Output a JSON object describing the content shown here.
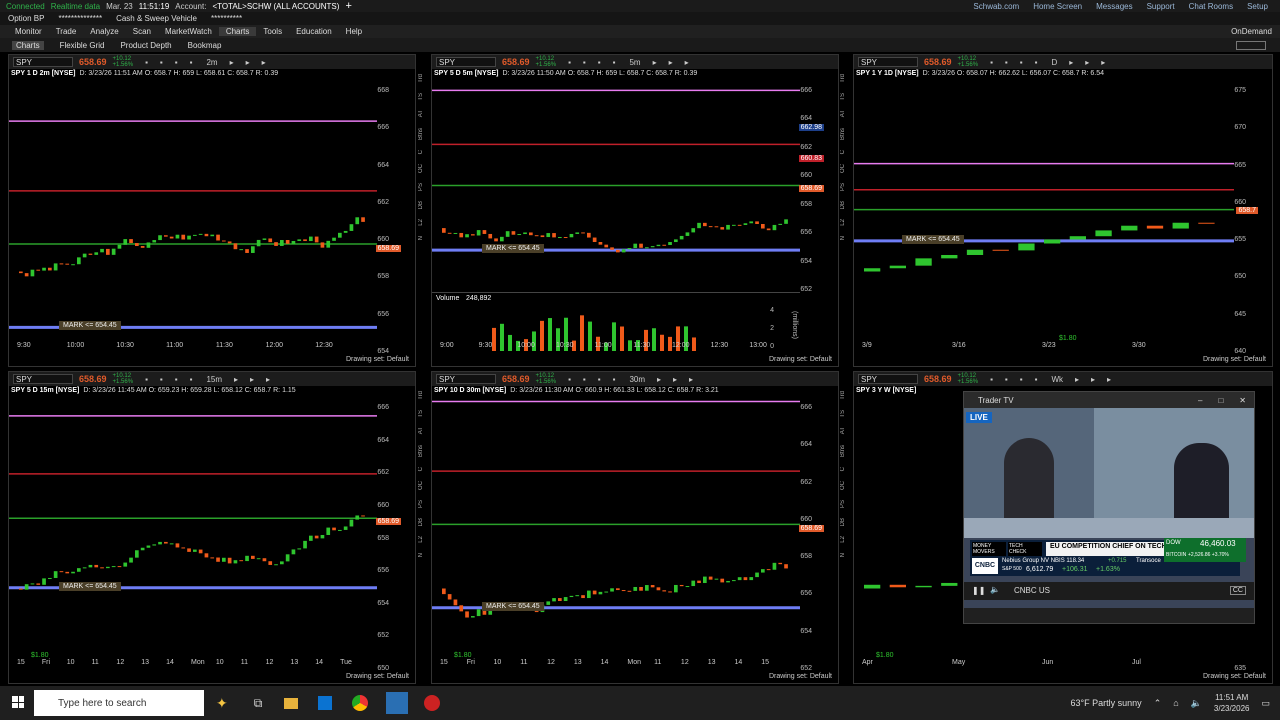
{
  "status": {
    "connected": "Connected",
    "realtime": "Realtime data",
    "date": "Mar. 23",
    "time": "11:51:19",
    "account_label": "Account:",
    "account": "<TOTAL>SCHW (ALL ACCOUNTS)"
  },
  "toplinks": [
    "Schwab.com",
    "Home Screen",
    "Messages",
    "Support",
    "Chat Rooms",
    "Setup"
  ],
  "row2": {
    "option_bp": "Option BP",
    "masked": "**************",
    "sweep": "Cash & Sweep Vehicle",
    "masked2": "**********"
  },
  "menu": [
    "Monitor",
    "Trade",
    "Analyze",
    "Scan",
    "MarketWatch",
    "Charts",
    "Tools",
    "Education",
    "Help"
  ],
  "ondemand": "OnDemand",
  "subtabs": [
    "Charts",
    "Flexible Grid",
    "Product Depth",
    "Bookmap"
  ],
  "panels": [
    {
      "symbol": "SPY",
      "price": "658.69",
      "chg1": "+10.12",
      "chg2": "+1.56%",
      "tf": "2m",
      "desc": "SPY 1 D 2m [NYSE]",
      "ohlc": "D: 3/23/26 11:51 AM O: 658.7 H: 659 L: 658.61 C: 658.7 R: 0.39",
      "yticks": [
        "668",
        "666",
        "664",
        "662",
        "660",
        "658",
        "656",
        "654"
      ],
      "xticks": [
        "9:30",
        "10:00",
        "10:30",
        "11:00",
        "11:30",
        "12:00",
        "12:30"
      ],
      "mark": "MARK <= 654.45",
      "last": "658.69",
      "drawing": "Drawing set: Default"
    },
    {
      "symbol": "SPY",
      "price": "658.69",
      "chg1": "+10.12",
      "chg2": "+1.56%",
      "tf": "5m",
      "desc": "SPY 5 D 5m [NYSE]",
      "ohlc": "D: 3/23/26 11:50 AM O: 658.7 H: 659 L: 658.7 C: 658.7 R: 0.39",
      "yticks": [
        "666",
        "664",
        "662",
        "660",
        "658",
        "656",
        "654",
        "652"
      ],
      "xticks": [
        "9:00",
        "9:30",
        "10:00",
        "10:30",
        "11:00",
        "11:30",
        "12:00",
        "12:30",
        "13:00"
      ],
      "mark": "MARK <= 654.45",
      "last": "658.69",
      "hi": "662.98",
      "mid": "660.83",
      "volume_label": "Volume",
      "volume": "248,892",
      "vol_axis": [
        "4",
        "2",
        "0"
      ],
      "vol_unit": "(millions)",
      "drawing": "Drawing set: Default"
    },
    {
      "symbol": "SPY",
      "price": "658.69",
      "chg1": "+10.12",
      "chg2": "+1.56%",
      "tf": "D",
      "desc": "SPY 1 Y 1D [NYSE]",
      "ohlc": "D: 3/23/26 O: 658.07 H: 662.62 L: 656.07 C: 658.7 R: 6.54",
      "yticks": [
        "675",
        "670",
        "665",
        "660",
        "655",
        "650",
        "645",
        "640"
      ],
      "xticks": [
        "3/9",
        "3/16",
        "3/23",
        "3/30"
      ],
      "mark": "MARK <= 654.45",
      "last": "658.7",
      "div": "$1.80",
      "drawing": "Drawing set: Default"
    },
    {
      "symbol": "SPY",
      "price": "658.69",
      "chg1": "+10.12",
      "chg2": "+1.56%",
      "tf": "15m",
      "desc": "SPY 5 D 15m [NYSE]",
      "ohlc": "D: 3/23/26 11:45 AM O: 659.23 H: 659.28 L: 658.12 C: 658.7 R: 1.15",
      "yticks": [
        "666",
        "664",
        "662",
        "660",
        "658",
        "656",
        "654",
        "652",
        "650"
      ],
      "xticks": [
        "15",
        "Fri",
        "10",
        "11",
        "12",
        "13",
        "14",
        "Mon",
        "10",
        "11",
        "12",
        "13",
        "14",
        "Tue"
      ],
      "mark": "MARK <= 654.45",
      "last": "658.69",
      "div": "$1.80",
      "drawing": "Drawing set: Default"
    },
    {
      "symbol": "SPY",
      "price": "658.69",
      "chg1": "+10.12",
      "chg2": "+1.56%",
      "tf": "30m",
      "desc": "SPY 10 D 30m [NYSE]",
      "ohlc": "D: 3/23/26 11:30 AM O: 660.9 H: 661.33 L: 658.12 C: 658.7 R: 3.21",
      "yticks": [
        "666",
        "664",
        "662",
        "660",
        "658",
        "656",
        "654",
        "652"
      ],
      "xticks": [
        "15",
        "Fri",
        "10",
        "11",
        "12",
        "13",
        "14",
        "Mon",
        "11",
        "12",
        "13",
        "14",
        "15"
      ],
      "mark": "MARK <= 654.45",
      "last": "658.69",
      "div": "$1.80",
      "drawing": "Drawing set: Default"
    },
    {
      "symbol": "SPY",
      "price": "658.69",
      "chg1": "+10.12",
      "chg2": "+1.56%",
      "tf": "Wk",
      "desc": "SPY 3 Y W [NYSE]",
      "ohlc": "",
      "yticks": [
        "640",
        "635"
      ],
      "xticks": [
        "Apr",
        "May",
        "Jun",
        "Jul"
      ],
      "mark": "MARK <= 654.45",
      "div": "$1.80",
      "drawing": "Drawing set: Default"
    }
  ],
  "side_labels": [
    "Trd",
    "TS",
    "AT",
    "Btns",
    "C",
    "OC",
    "PS",
    "DB",
    "L2",
    "N"
  ],
  "tv": {
    "title": "Trader TV",
    "live": "LIVE",
    "tag1": "MONEY MOVERS",
    "tag2": "TECH CHECK",
    "headline": "EU COMPETITION CHIEF ON TECH REGULATION",
    "ticker1": "Nebius Group NV NBIS 118.34",
    "ticker1c": "+0.715",
    "ticker2": "Transoce",
    "sp_label": "S&P 500",
    "sp": "6,612.79",
    "sp_chg": "+106.31",
    "sp_pct": "+1.63%",
    "dow_label": "DOW",
    "dow": "46,460.03",
    "btc_label": "BITCOIN",
    "btc": "+2,526.86 +3.70%",
    "channel": "CNBC US",
    "brand": "CNBC"
  },
  "taskbar": {
    "search": "Type here to search",
    "weather": "63°F  Partly sunny",
    "time": "11:51 AM",
    "date": "3/23/2026"
  }
}
